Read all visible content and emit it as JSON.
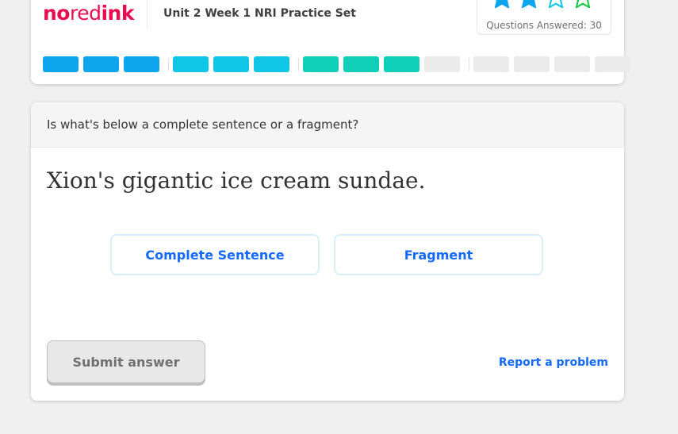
{
  "header": {
    "logo": {
      "part1": "no",
      "part2": "red",
      "part3": "ink"
    },
    "assignment_title": "Unit 2 Week 1 NRI Practice Set",
    "progress": {
      "stars_earned": 2,
      "stars_total": 4,
      "questions_answered_text": "Questions Answered: 30"
    },
    "segments": {
      "groups": [
        [
          "#0ea5ef",
          "#0ea5ef",
          "#0ea5ef"
        ],
        [
          "#0fc6e6",
          "#0fc6e6",
          "#0fc6e6"
        ],
        [
          "#0fcfb8",
          "#0fcfb8",
          "#0fcfb8",
          "#ebebeb"
        ],
        [
          "#ebebeb",
          "#ebebeb",
          "#ebebeb",
          "#ebebeb"
        ]
      ]
    }
  },
  "question": {
    "prompt": "Is what's below a complete sentence or a fragment?",
    "sentence": "Xion's gigantic ice cream sundae.",
    "choices": [
      "Complete Sentence",
      "Fragment"
    ],
    "submit_label": "Submit answer",
    "report_label": "Report a problem"
  },
  "colors": {
    "brand": "#e70d4f",
    "link": "#146aff",
    "star_filled": "#0ea5ef",
    "star_outline_1": "#0fc6e6",
    "star_outline_2": "#10c840"
  }
}
